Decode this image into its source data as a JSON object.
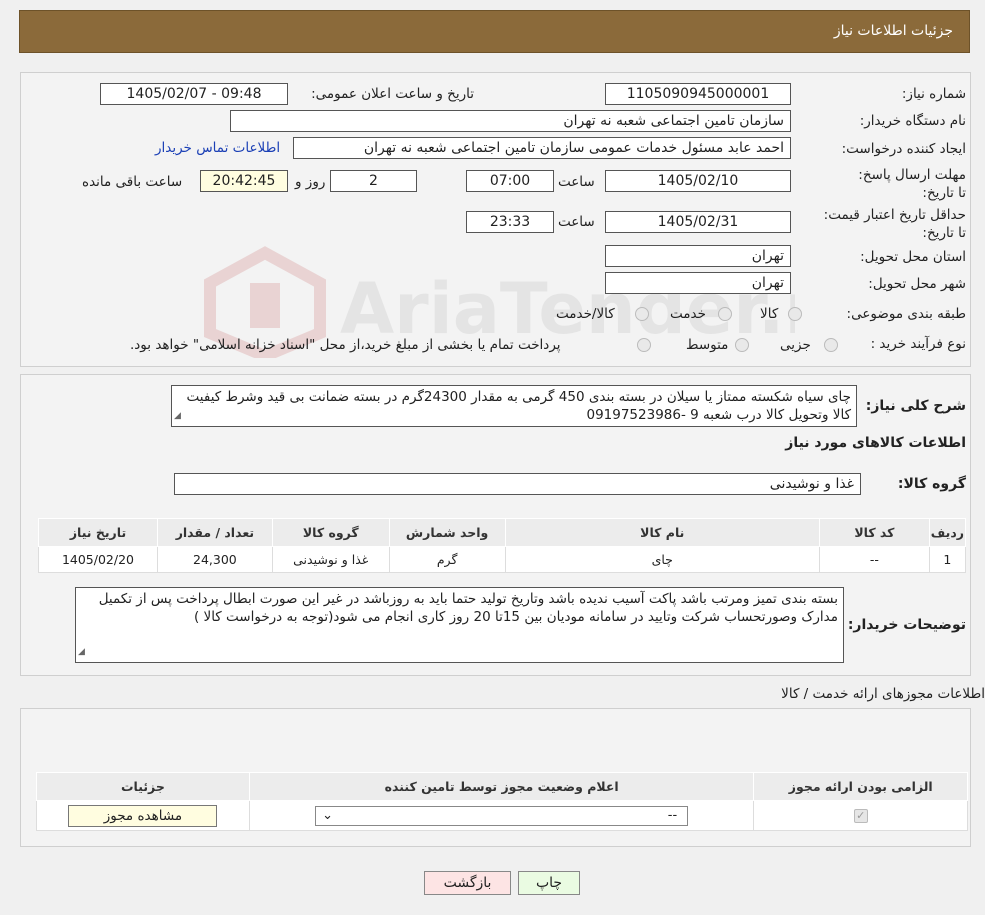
{
  "header": {
    "title": "جزئیات اطلاعات نیاز"
  },
  "form": {
    "need_number": {
      "label": "شماره نیاز:",
      "value": "1105090945000001"
    },
    "announce": {
      "label": "تاریخ و ساعت اعلان عمومی:",
      "value": "1405/02/07 - 09:48"
    },
    "buyer_org": {
      "label": "نام دستگاه خریدار:",
      "value": "سازمان تامین اجتماعی شعبه نه تهران"
    },
    "requester": {
      "label": "ایجاد کننده درخواست:",
      "value": "احمد عابد مسئول خدمات عمومی سازمان تامین اجتماعی شعبه نه تهران",
      "contact_link": "اطلاعات تماس خریدار"
    },
    "reply_deadline": {
      "label": "مهلت ارسال پاسخ: تا تاریخ:",
      "date": "1405/02/10",
      "time_label": "ساعت",
      "time": "07:00",
      "days": "2",
      "days_label": "روز و",
      "remaining": "20:42:45",
      "remaining_label": "ساعت باقی مانده"
    },
    "price_validity": {
      "label": "حداقل تاریخ اعتبار قیمت: تا تاریخ:",
      "date": "1405/02/31",
      "time_label": "ساعت",
      "time": "23:33"
    },
    "province": {
      "label": "استان محل تحویل:",
      "value": "تهران"
    },
    "city": {
      "label": "شهر محل تحویل:",
      "value": "تهران"
    },
    "category": {
      "label": "طبقه بندی موضوعی:",
      "options": [
        "کالا",
        "خدمت",
        "کالا/خدمت"
      ]
    },
    "purchase_type": {
      "label": "نوع فرآیند خرید :",
      "options": [
        "جزیی",
        "متوسط"
      ],
      "note": "پرداخت تمام یا بخشی از مبلغ خرید،از محل \"اسناد خزانه اسلامی\" خواهد بود."
    }
  },
  "description": {
    "label": "شرح کلی نیاز:",
    "text": "چای سیاه شکسته ممتاز یا سیلان در بسته بندی 450 گرمی به مقدار 24300گرم در بسته ضمانت بی قید وشرط کیفیت کالا وتحویل کالا درب شعبه 9 -09197523986"
  },
  "goods": {
    "title": "اطلاعات کالاهای مورد نیاز",
    "group_label": "گروه کالا:",
    "group_value": "غذا و نوشیدنی",
    "columns": [
      "ردیف",
      "کد کالا",
      "نام کالا",
      "واحد شمارش",
      "گروه کالا",
      "تعداد / مقدار",
      "تاریخ نیاز"
    ],
    "rows": [
      [
        "1",
        "--",
        "چای",
        "گرم",
        "غذا و نوشیدنی",
        "24,300",
        "1405/02/20"
      ]
    ]
  },
  "buyer_notes": {
    "label": "توضیحات خریدار:",
    "text": "بسته بندی تمیز ومرتب باشد  پاکت آسیب ندیده باشد وتاریخ تولید حتما باید به روزباشد در غیر این صورت ابطال پرداخت پس از تکمیل مدارک وصورتحساب شرکت وتایید در سامانه مودیان بین 15تا 20 روز کاری انجام می شود(توجه به درخواست کالا )"
  },
  "permits": {
    "title": "اطلاعات مجوزهای ارائه خدمت / کالا",
    "columns": [
      "الزامی بودن ارائه مجوز",
      "اعلام وضعیت مجوز توسط تامین کننده",
      "جزئیات"
    ],
    "row": {
      "select_value": "--",
      "view_button": "مشاهده مجوز"
    }
  },
  "footer": {
    "print": "چاپ",
    "back": "بازگشت"
  },
  "watermark": {
    "text": "AriaTender.neT"
  }
}
